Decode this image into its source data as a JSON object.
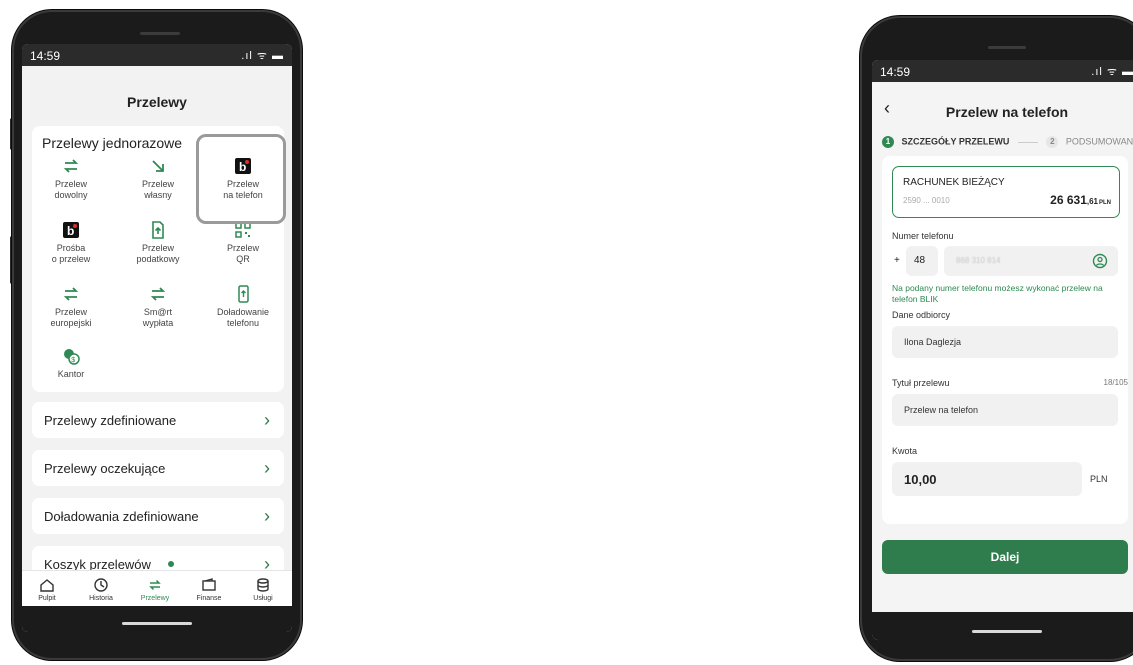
{
  "left_phone": {
    "status_time": "14:59",
    "status_icons": ".ıl ᯤ ▬",
    "title": "Przelewy",
    "one_time_section": {
      "title": "Przelewy jednorazowe",
      "tiles": [
        {
          "line1": "Przelew",
          "line2": "dowolny",
          "icon": "transfer-arrows-icon"
        },
        {
          "line1": "Przelew",
          "line2": "własny",
          "icon": "arrow-down-right-icon"
        },
        {
          "line1": "Przelew",
          "line2": "na telefon",
          "icon": "blik-icon"
        },
        {
          "line1": "Prośba",
          "line2": "o przelew",
          "icon": "blik-icon"
        },
        {
          "line1": "Przelew",
          "line2": "podatkowy",
          "icon": "tax-document-icon"
        },
        {
          "line1": "Przelew",
          "line2": "QR",
          "icon": "qr-code-icon"
        },
        {
          "line1": "Przelew",
          "line2": "europejski",
          "icon": "transfer-arrows-icon"
        },
        {
          "line1": "Sm@rt",
          "line2": "wypłata",
          "icon": "transfer-arrows-icon"
        },
        {
          "line1": "Doładowanie",
          "line2": "telefonu",
          "icon": "phone-topup-icon"
        },
        {
          "line1": "Kantor",
          "line2": "",
          "icon": "currency-exchange-icon"
        }
      ]
    },
    "rows": [
      {
        "label": "Przelewy zdefiniowane"
      },
      {
        "label": "Przelewy oczekujące"
      },
      {
        "label": "Doładowania zdefiniowane"
      },
      {
        "label": "Koszyk przelewów"
      }
    ],
    "tabs": [
      {
        "label": "Pulpit",
        "icon": "home-icon"
      },
      {
        "label": "Historia",
        "icon": "history-icon"
      },
      {
        "label": "Przelewy",
        "icon": "transfer-arrows-icon",
        "active": true
      },
      {
        "label": "Finanse",
        "icon": "wallet-icon"
      },
      {
        "label": "Usługi",
        "icon": "services-icon"
      }
    ]
  },
  "right_phone": {
    "status_time": "14:59",
    "status_icons": ".ıl ᯤ ▬",
    "title": "Przelew na telefon",
    "steps": [
      {
        "num": "1",
        "label": "SZCZEGÓŁY PRZELEWU"
      },
      {
        "num": "2",
        "label": "PODSUMOWANI"
      }
    ],
    "account": {
      "name": "RACHUNEK BIEŻĄCY",
      "number": "2590 ... 0010",
      "balance_main": "26 631",
      "balance_cents": ",61",
      "currency": "PLN"
    },
    "phone_label": "Numer telefonu",
    "phone_prefix_plus": "+",
    "phone_prefix": "48",
    "phone_number_masked": "868 310 814",
    "note": "Na podany numer telefonu możesz wykonać przelew na telefon BLIK",
    "recipient_label": "Dane odbiorcy",
    "recipient_value": "Ilona Daglezja",
    "title_label": "Tytuł przelewu",
    "title_counter": "18/105",
    "title_value": "Przelew na telefon",
    "amount_label": "Kwota",
    "amount_value": "10,00",
    "amount_currency": "PLN",
    "next_button": "Dalej"
  },
  "colors": {
    "accent_green": "#2e8a52",
    "button_green": "#2f7d4d",
    "highlight_box": "#9a9a9a"
  }
}
